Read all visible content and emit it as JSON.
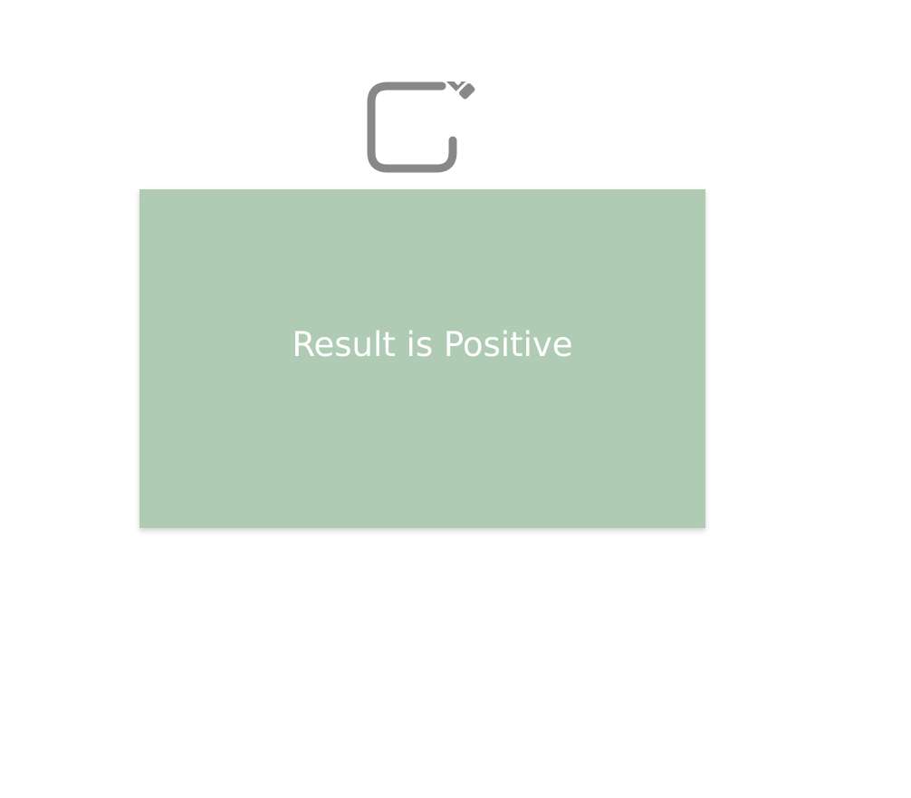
{
  "edit": {
    "icon": "edit-pencil-icon",
    "color": "#888888"
  },
  "result": {
    "text": "Result is Positive",
    "background": "#afcbb3",
    "text_color": "#ffffff"
  }
}
